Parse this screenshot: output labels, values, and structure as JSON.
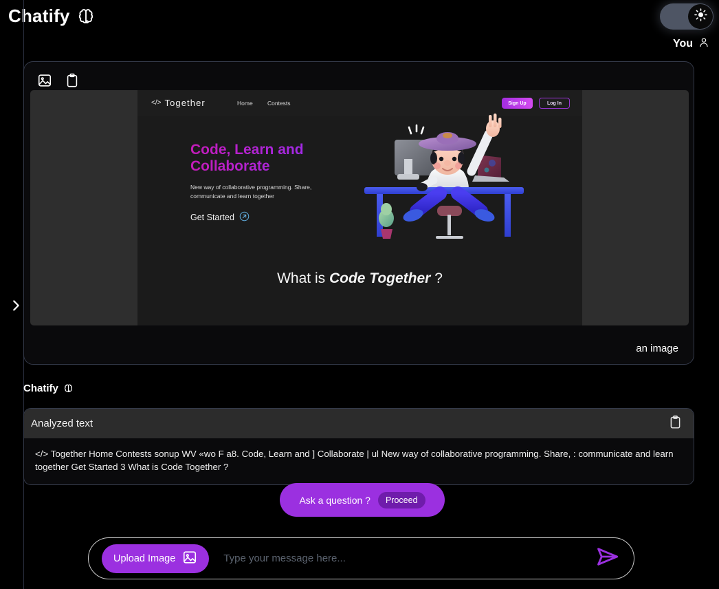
{
  "header": {
    "app_name": "Chatify",
    "brain_icon": "brain-icon",
    "theme_toggle_icon": "sun-icon",
    "user_label": "You",
    "user_icon": "person-icon"
  },
  "sidebar": {
    "expand_icon": "chevron-right-icon"
  },
  "user_message": {
    "image_icon": "image-icon",
    "clipboard_icon": "clipboard-icon",
    "caption": "an image",
    "attachment": {
      "nav": {
        "logo_prefix": "</>",
        "logo_text": "Together",
        "links": [
          "Home",
          "Contests"
        ],
        "signup_label": "Sign Up",
        "login_label": "Log In"
      },
      "hero": {
        "title": "Code, Learn and Collaborate",
        "subtitle": "New way of collaborative programming. Share, communicate and learn together",
        "cta_label": "Get Started",
        "cta_icon": "arrow-up-right-circle-icon"
      },
      "section": {
        "prefix": "What is ",
        "emphasis": "Code Together",
        "suffix": " ?"
      },
      "illustration": "person-at-desk-illustration"
    }
  },
  "bot_message": {
    "label": "Chatify",
    "brain_icon": "brain-icon",
    "panel_title": "Analyzed text",
    "copy_icon": "clipboard-icon",
    "analyzed_text": "</> Together Home Contests sonup WV «wo F a8. Code, Learn and ] Collaborate | ul New way of collaborative programming. Share, : communicate and learn together Get Started 3 What is Code Together ?"
  },
  "ask": {
    "label": "Ask a question ?",
    "proceed_label": "Proceed"
  },
  "composer": {
    "upload_label": "Upload Image",
    "upload_icon": "image-icon",
    "input_value": "",
    "input_placeholder": "Type your message here...",
    "send_icon": "send-icon"
  },
  "colors": {
    "background": "#000000",
    "accent_purple": "#9b30e0",
    "accent_dark_purple": "#6f1cab",
    "panel": "#0a0a0c",
    "panel_border": "#343a4a",
    "header_bar": "#2c2c2c",
    "gradient_start": "#c41bb8",
    "gradient_end": "#9b2df0"
  }
}
